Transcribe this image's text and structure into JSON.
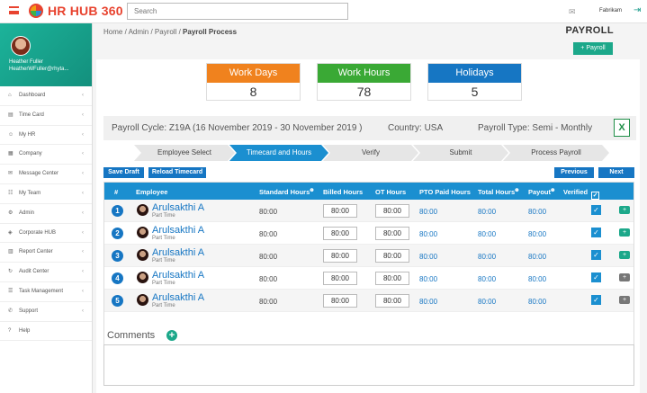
{
  "app": {
    "name": "HR HUB 360",
    "search_placeholder": "Search",
    "company": "Fabrikam"
  },
  "user": {
    "name": "Heather Fuller",
    "email": "HeatherWFuller@rhyta..."
  },
  "sidebar": {
    "items": [
      {
        "label": "Dashboard",
        "icon": "dashboard-icon"
      },
      {
        "label": "Time Card",
        "icon": "timecard-icon"
      },
      {
        "label": "My HR",
        "icon": "user-icon"
      },
      {
        "label": "Company",
        "icon": "company-icon"
      },
      {
        "label": "Message Center",
        "icon": "message-icon"
      },
      {
        "label": "My Team",
        "icon": "team-icon"
      },
      {
        "label": "Admin",
        "icon": "admin-icon"
      },
      {
        "label": "Corporate HUB",
        "icon": "hub-icon"
      },
      {
        "label": "Report Center",
        "icon": "report-icon"
      },
      {
        "label": "Audit Center",
        "icon": "audit-icon"
      },
      {
        "label": "Task Management",
        "icon": "task-icon"
      },
      {
        "label": "Support",
        "icon": "support-icon"
      },
      {
        "label": "Help",
        "icon": "help-icon"
      }
    ]
  },
  "breadcrumb": {
    "trail": "Home / Admin / Payroll / ",
    "current": "Payroll Process"
  },
  "page": {
    "title": "PAYROLL",
    "add_button": "+ Payroll"
  },
  "stats": [
    {
      "label": "Work Days",
      "value": "8",
      "color": "#f0821e"
    },
    {
      "label": "Work Hours",
      "value": "78",
      "color": "#3aa935"
    },
    {
      "label": "Holidays",
      "value": "5",
      "color": "#1676c3"
    }
  ],
  "cycle": {
    "cycle_label": "Payroll Cycle:",
    "cycle_value": "Z19A (16 November 2019 - 30 November 2019 )",
    "country_label": "Country:",
    "country_value": "USA",
    "type_label": "Payroll Type:",
    "type_value": "Semi - Monthly"
  },
  "steps": [
    {
      "label": "Employee Select",
      "active": false
    },
    {
      "label": "Timecard and Hours",
      "active": true
    },
    {
      "label": "Verify",
      "active": false
    },
    {
      "label": "Submit",
      "active": false
    },
    {
      "label": "Process Payroll",
      "active": false
    }
  ],
  "actions": {
    "save_draft": "Save Draft",
    "reload": "Reload Timecard",
    "previous": "Previous",
    "next": "Next"
  },
  "table": {
    "headers": {
      "num": "#",
      "employee": "Employee",
      "standard": "Standard Hours",
      "billed": "Billed Hours",
      "ot": "OT Hours",
      "pto": "PTO Paid Hours",
      "total": "Total Hours",
      "payout": "Payout",
      "verified": "Verified"
    },
    "rows": [
      {
        "num": "1",
        "name": "Arulsakthi A",
        "type": "Part Time",
        "standard": "80:00",
        "billed": "80:00",
        "ot": "80:00",
        "pto": "80:00",
        "total": "80:00",
        "payout": "80:00",
        "comment_color": "#1ca88a"
      },
      {
        "num": "2",
        "name": "Arulsakthi A",
        "type": "Part Time",
        "standard": "80:00",
        "billed": "80:00",
        "ot": "80:00",
        "pto": "80:00",
        "total": "80:00",
        "payout": "80:00",
        "comment_color": "#1ca88a"
      },
      {
        "num": "3",
        "name": "Arulsakthi A",
        "type": "Part Time",
        "standard": "80:00",
        "billed": "80:00",
        "ot": "80:00",
        "pto": "80:00",
        "total": "80:00",
        "payout": "80:00",
        "comment_color": "#1ca88a"
      },
      {
        "num": "4",
        "name": "Arulsakthi A",
        "type": "Part Time",
        "standard": "80:00",
        "billed": "80:00",
        "ot": "80:00",
        "pto": "80:00",
        "total": "80:00",
        "payout": "80:00",
        "comment_color": "#777777"
      },
      {
        "num": "5",
        "name": "Arulsakthi A",
        "type": "Part Time",
        "standard": "80:00",
        "billed": "80:00",
        "ot": "80:00",
        "pto": "80:00",
        "total": "80:00",
        "payout": "80:00",
        "comment_color": "#777777"
      }
    ]
  },
  "comments": {
    "label": "Comments"
  }
}
